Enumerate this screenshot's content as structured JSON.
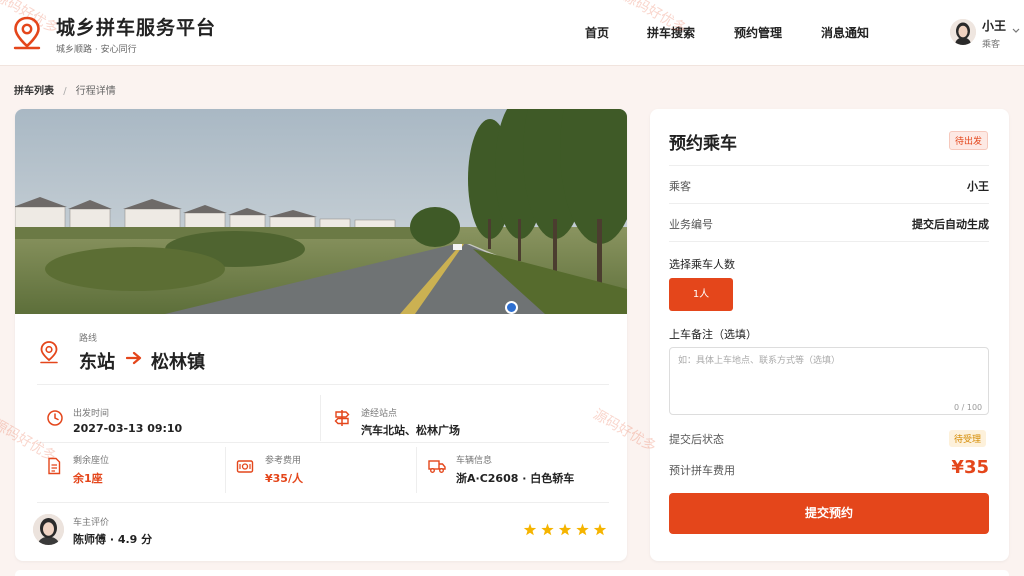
{
  "header": {
    "title": "城乡拼车服务平台",
    "subtitle": "城乡顺路 · 安心同行",
    "nav": [
      "首页",
      "拼车搜索",
      "预约管理",
      "消息通知"
    ],
    "user": {
      "name": "小王",
      "role": "乘客"
    }
  },
  "breadcrumb": {
    "parent": "拼车列表",
    "separator": "/",
    "current": "行程详情"
  },
  "trip": {
    "route_label": "路线",
    "from": "东站",
    "to": "松林镇",
    "departure_label": "出发时间",
    "departure_value": "2027-03-13 09:10",
    "stops_label": "途经站点",
    "stops_value": "汽车北站、松林广场",
    "seats_label": "剩余座位",
    "seats_value": "余1座",
    "fee_label": "参考费用",
    "fee_value": "¥35/人",
    "vehicle_label": "车辆信息",
    "vehicle_value": "浙A·C2608 · 白色轿车",
    "rating_label": "车主评价",
    "driver_value": "陈师傅 · 4.9 分",
    "stars": 5
  },
  "booking": {
    "title": "预约乘车",
    "status_badge": "待出发",
    "passenger_label": "乘客",
    "passenger_value": "小王",
    "order_label": "业务编号",
    "order_value": "提交后自动生成",
    "count_label": "选择乘车人数",
    "count_option": "1人",
    "note_label": "上车备注（选填）",
    "note_placeholder": "如：具体上车地点、联系方式等（选填）",
    "note_counter": "0 / 100",
    "after_label": "提交后状态",
    "after_badge": "待受理",
    "fee_label": "预计拼车费用",
    "fee_value": "¥35",
    "submit_label": "提交预约"
  },
  "watermark": "源码好优多",
  "colors": {
    "accent": "#e4461b",
    "background": "#fbf3f0",
    "star": "#f5b400"
  }
}
